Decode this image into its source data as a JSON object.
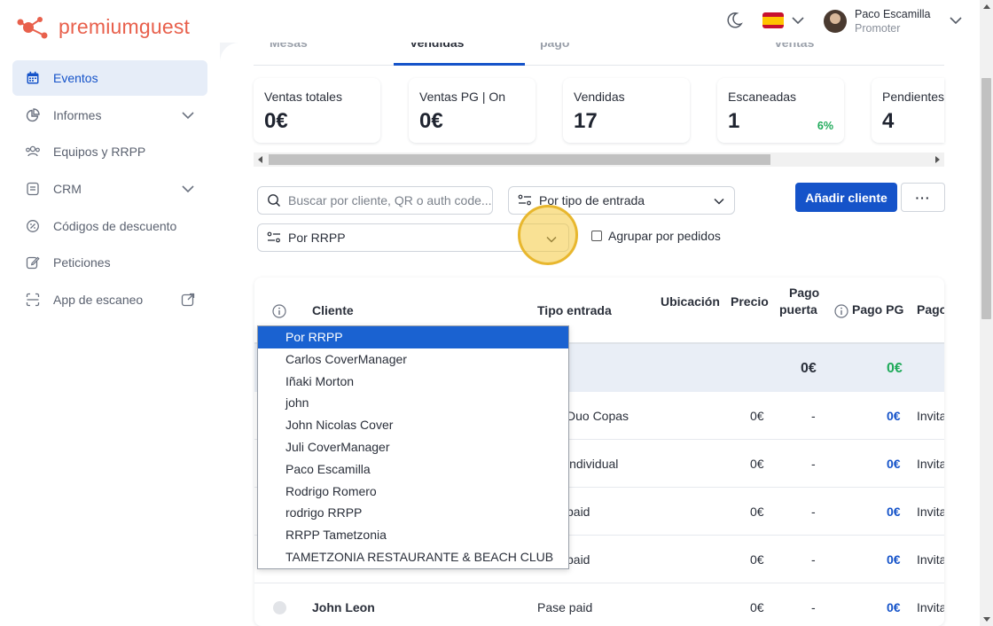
{
  "brand": {
    "name": "premiumguest",
    "color": "#e8604c"
  },
  "accent": "#1553c9",
  "sidebar": {
    "items": [
      {
        "label": "Eventos",
        "icon": "calendar-icon",
        "active": true
      },
      {
        "label": "Informes",
        "icon": "pie-chart-icon",
        "expandable": true
      },
      {
        "label": "Equipos y RRPP",
        "icon": "team-icon"
      },
      {
        "label": "CRM",
        "icon": "document-list-icon",
        "expandable": true
      },
      {
        "label": "Códigos de descuento",
        "icon": "discount-icon"
      },
      {
        "label": "Peticiones",
        "icon": "edit-icon"
      },
      {
        "label": "App de escaneo",
        "icon": "scan-icon",
        "external": true
      }
    ]
  },
  "topbar": {
    "user_name": "Paco Escamilla",
    "user_role": "Promoter",
    "language_flag": "es-flag-icon"
  },
  "tabs": [
    {
      "label": "Mesas"
    },
    {
      "label": "Vendidas",
      "active": true
    },
    {
      "label": "pago"
    },
    {
      "label": "ventas"
    }
  ],
  "stats": [
    {
      "label": "Ventas totales",
      "value": "0€"
    },
    {
      "label": "Ventas PG | On",
      "value": "0€"
    },
    {
      "label": "Vendidas",
      "value": "17"
    },
    {
      "label": "Escaneadas",
      "value": "1",
      "percent": "6%"
    },
    {
      "label": "Pendientes",
      "value": "4"
    }
  ],
  "filters": {
    "search_placeholder": "Buscar por cliente, QR o auth code...",
    "ticket_type": "Por tipo de entrada",
    "rrpp": "Por RRPP",
    "group_by_orders": "Agrupar por pedidos",
    "add_client": "Añadir cliente",
    "more": "···"
  },
  "table": {
    "headers": {
      "client": "Cliente",
      "ticket_type": "Tipo entrada",
      "location": "Ubicación",
      "price": "Precio",
      "door_payment_1": "Pago",
      "door_payment_2": "puerta",
      "pg_payment": "Pago PG",
      "payment": "Pago"
    },
    "subtotal": {
      "door": "0€",
      "pg": "0€"
    },
    "rows": [
      {
        "client": "",
        "ticket_type": "Duo Copas",
        "price": "0€",
        "door": "-",
        "pg": "0€",
        "payment": "Invita"
      },
      {
        "client": "",
        "ticket_type": "individual",
        "price": "0€",
        "door": "-",
        "pg": "0€",
        "payment": "Invita"
      },
      {
        "client": "",
        "ticket_type": "paid",
        "price": "0€",
        "door": "-",
        "pg": "0€",
        "payment": "Invita"
      },
      {
        "client": "",
        "ticket_type": "paid",
        "price": "0€",
        "door": "-",
        "pg": "0€",
        "payment": "Invita"
      },
      {
        "client": "John Leon",
        "ticket_type": "Pase paid",
        "price": "0€",
        "door": "-",
        "pg": "0€",
        "payment": "Invita"
      }
    ]
  },
  "rrpp_dropdown": {
    "options": [
      "Por RRPP",
      "Carlos CoverManager",
      "Iñaki Morton",
      "john",
      "John Nicolas Cover",
      "Juli CoverManager",
      "Paco Escamilla",
      "Rodrigo Romero",
      "rodrigo RRPP",
      "RRPP Tametzonia",
      "TAMETZONIA RESTAURANTE & BEACH CLUB"
    ],
    "selected": "Por RRPP"
  }
}
